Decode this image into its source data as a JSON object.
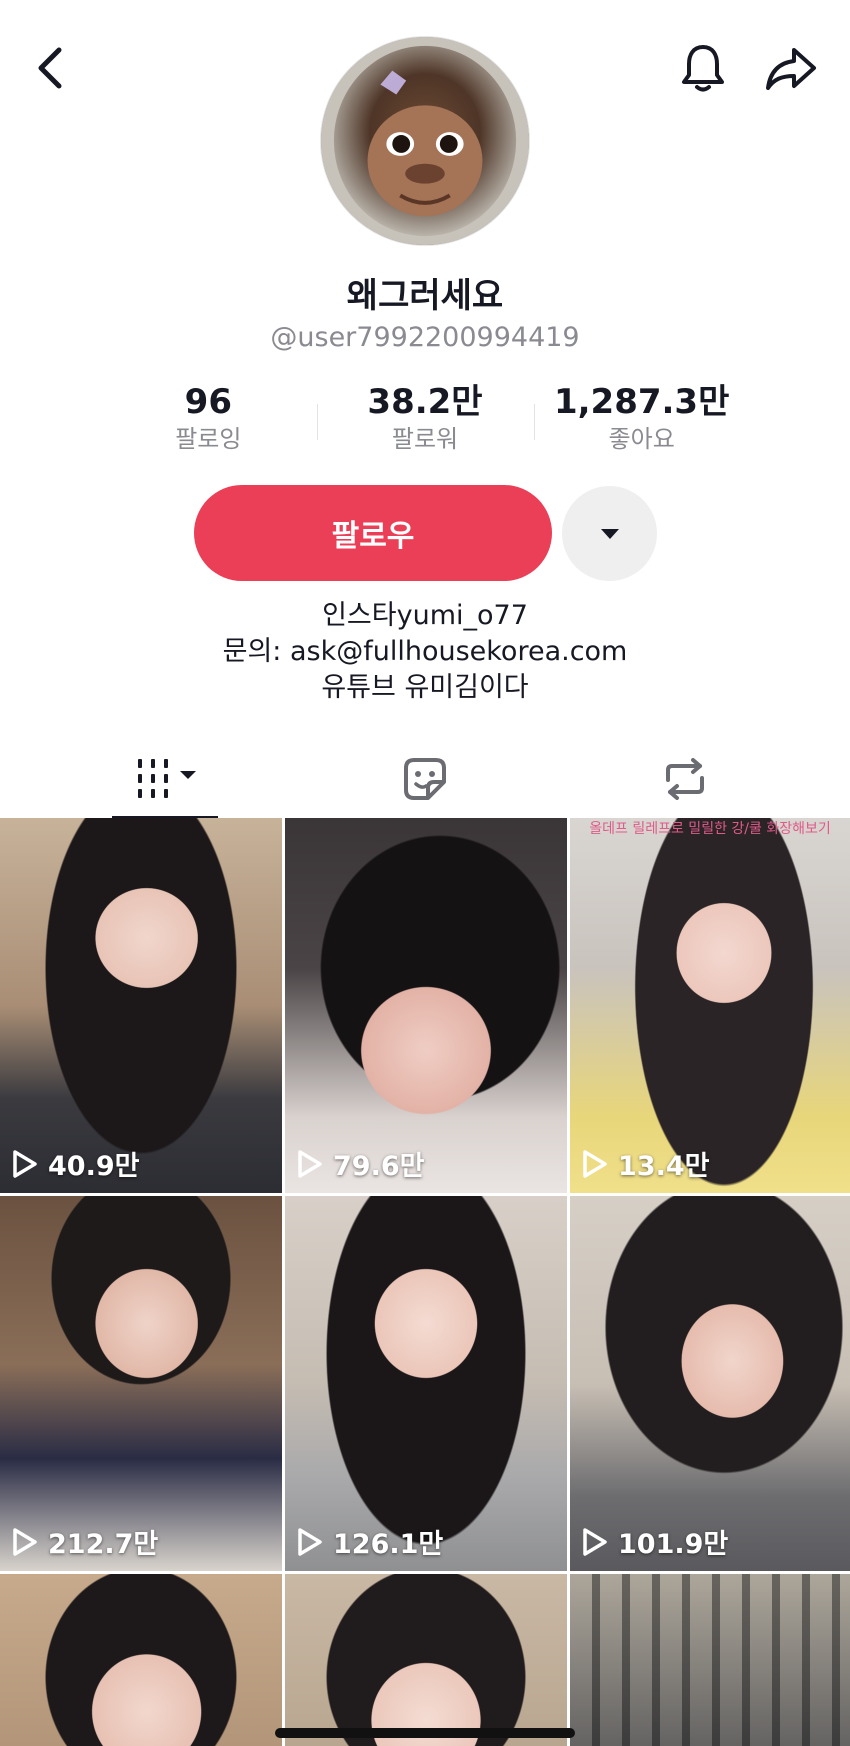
{
  "header": {
    "back_icon": "chevron-left-icon",
    "bell_icon": "bell-icon",
    "share_icon": "share-arrow-icon"
  },
  "profile": {
    "display_name": "왜그러세요",
    "handle": "@user7992200994419"
  },
  "stats": [
    {
      "value": "96",
      "label": "팔로잉"
    },
    {
      "value": "38.2만",
      "label": "팔로워"
    },
    {
      "value": "1,287.3만",
      "label": "좋아요"
    }
  ],
  "actions": {
    "follow_label": "팔로우",
    "dropdown_icon": "caret-down-icon"
  },
  "bio": {
    "lines": [
      "인스타yumi_o77",
      "문의: ask@fullhousekorea.com",
      "유튜브 유미김이다"
    ]
  },
  "tabs": [
    {
      "name": "videos",
      "icon": "grid-bars-icon",
      "selected": true
    },
    {
      "name": "liked",
      "icon": "sticker-icon",
      "selected": false
    },
    {
      "name": "reposts",
      "icon": "repost-icon",
      "selected": false
    }
  ],
  "videos": [
    {
      "views": "40.9만"
    },
    {
      "views": "79.6만"
    },
    {
      "views": "13.4만",
      "caption": "올데프 릴레프로 밀릴한 강/쿨 화장해보기"
    },
    {
      "views": "212.7만"
    },
    {
      "views": "126.1만"
    },
    {
      "views": "101.9만"
    },
    {
      "views": ""
    },
    {
      "views": ""
    },
    {
      "views": ""
    }
  ],
  "colors": {
    "follow": "#ea3f56",
    "text_primary": "#161823",
    "text_secondary": "#8a8b91"
  }
}
